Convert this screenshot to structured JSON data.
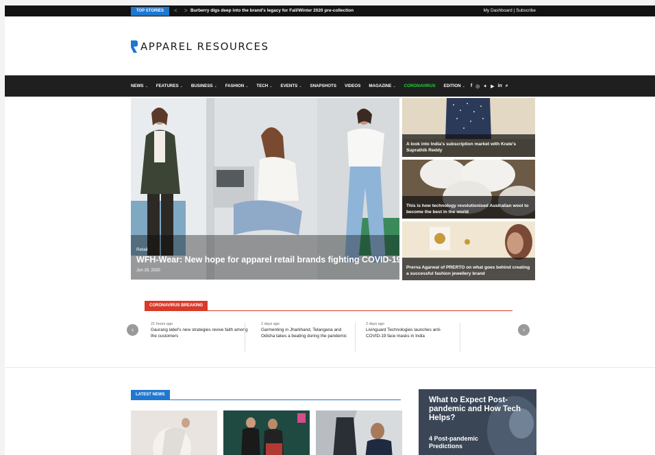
{
  "topbar": {
    "label": "TOP STORIES",
    "arrows": "< >",
    "headline": "Burberry digs deep into the brand's legacy for Fall/Winter 2020 pre-collection",
    "my_dashboard": "My Dashboard",
    "separator": "|",
    "subscribe": "Subscribe"
  },
  "logo": {
    "text": "APPAREL RESOURCES",
    "color": "#1f77d0"
  },
  "nav": {
    "items": [
      {
        "label": "NEWS",
        "dropdown": true
      },
      {
        "label": "FEATURES",
        "dropdown": true
      },
      {
        "label": "BUSINESS",
        "dropdown": true
      },
      {
        "label": "FASHION",
        "dropdown": true
      },
      {
        "label": "TECH",
        "dropdown": true
      },
      {
        "label": "EVENTS",
        "dropdown": true
      },
      {
        "label": "SNAPSHOTS",
        "dropdown": false
      },
      {
        "label": "VIDEOS",
        "dropdown": false
      },
      {
        "label": "MAGAZINE",
        "dropdown": true
      },
      {
        "label": "CORONAVIRUS",
        "dropdown": false,
        "highlight": true
      },
      {
        "label": "EDITION",
        "dropdown": true
      }
    ],
    "social": [
      "f",
      "◎",
      "✦",
      "▶",
      "in"
    ],
    "highlight_color": "#24d43a"
  },
  "hero": {
    "category": "Retail",
    "title": "WFH-Wear: New hope for apparel retail brands fighting COVID-19",
    "date": "Jun 19, 2020"
  },
  "side_stories": [
    {
      "title": "A look into India's subscription market with Krate's Suprathik Reddy"
    },
    {
      "title": "This is how technology revolutionised Australian wool to become the best in the world"
    },
    {
      "title": "Prerna Agarwal of PRERTO on what goes behind creating a successful fashion jewellery brand"
    }
  ],
  "coronavirus_breaking": {
    "label": "CORONAVIRUS BREAKING",
    "color": "#d93a2a",
    "prev": "‹",
    "next": "›",
    "items": [
      {
        "time": "21 hours ago",
        "text": "Gaurang label's new strategies revive faith among the customers"
      },
      {
        "time": "2 days ago",
        "text": "Garmenting in Jharkhand, Telangana and Odisha takes a beating during the pandemic"
      },
      {
        "time": "2 days ago",
        "text": "Livinguard Technologies launches anti-COVID-19 face masks in India"
      }
    ]
  },
  "latest_news": {
    "label": "LATEST NEWS",
    "color": "#1f77d0"
  },
  "ad": {
    "title": "What to Expect Post-pandemic and How Tech Helps?",
    "subtitle": "4 Post-pandemic Predictions"
  }
}
